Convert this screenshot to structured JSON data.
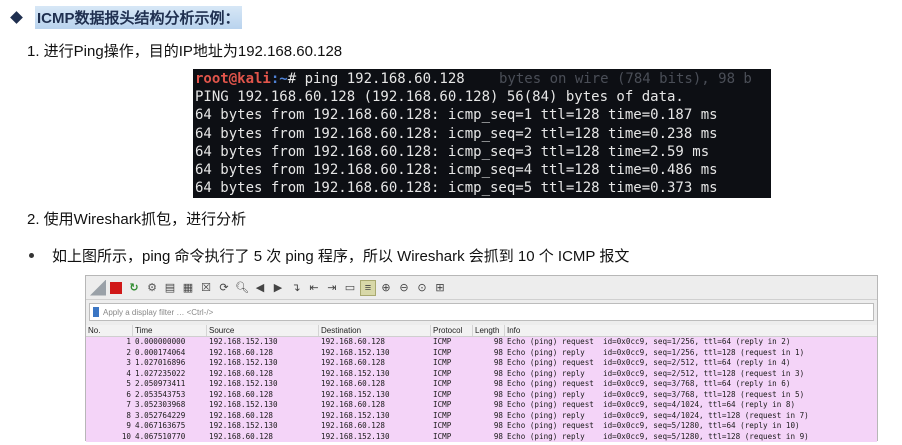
{
  "heading": "ICMP数据报头结构分析示例：",
  "step1": "1.  进行Ping操作，目的IP地址为192.168.60.128",
  "step2": "2.  使用Wireshark抓包，进行分析",
  "bullet": "如上图所示，ping 命令执行了 5 次 ping 程序，所以 Wireshark 会抓到 10 个 ICMP 报文",
  "terminal": {
    "user_host": "root@kali",
    "path": ":~",
    "prompt": "# ping 192.168.60.128",
    "ghost_top": "bytes on wire (784 bits), 98 b",
    "lines": [
      "PING 192.168.60.128 (192.168.60.128) 56(84) bytes of data.",
      "64 bytes from 192.168.60.128: icmp_seq=1 ttl=128 time=0.187 ms",
      "64 bytes from 192.168.60.128: icmp_seq=2 ttl=128 time=0.238 ms",
      "64 bytes from 192.168.60.128: icmp_seq=3 ttl=128 time=2.59 ms",
      "64 bytes from 192.168.60.128: icmp_seq=4 ttl=128 time=0.486 ms",
      "64 bytes from 192.168.60.128: icmp_seq=5 ttl=128 time=0.373 ms"
    ]
  },
  "wireshark": {
    "filter_placeholder": "Apply a display filter … <Ctrl-/>",
    "toolbar_icons": [
      "shark-fin-icon",
      "stop-icon",
      "restart-icon",
      "options-gear-icon",
      "open-file-icon",
      "save-file-icon",
      "close-file-icon",
      "reload-icon",
      "find-icon",
      "back-arrow-icon",
      "forward-arrow-icon",
      "goto-packet-icon",
      "first-packet-icon",
      "last-packet-icon",
      "autoscroll-icon",
      "colorize-icon",
      "zoom-in-icon",
      "zoom-out-icon",
      "zoom-normal-icon",
      "resize-columns-icon"
    ],
    "columns": [
      "No.",
      "Time",
      "Source",
      "Destination",
      "Protocol",
      "Length",
      "Info"
    ],
    "rows": [
      [
        "1",
        "0.000000000",
        "192.168.152.130",
        "192.168.60.128",
        "ICMP",
        "98",
        "Echo (ping) request  id=0x0cc9, seq=1/256, ttl=64 (reply in 2)"
      ],
      [
        "2",
        "0.000174064",
        "192.168.60.128",
        "192.168.152.130",
        "ICMP",
        "98",
        "Echo (ping) reply    id=0x0cc9, seq=1/256, ttl=128 (request in 1)"
      ],
      [
        "3",
        "1.027016896",
        "192.168.152.130",
        "192.168.60.128",
        "ICMP",
        "98",
        "Echo (ping) request  id=0x0cc9, seq=2/512, ttl=64 (reply in 4)"
      ],
      [
        "4",
        "1.027235022",
        "192.168.60.128",
        "192.168.152.130",
        "ICMP",
        "98",
        "Echo (ping) reply    id=0x0cc9, seq=2/512, ttl=128 (request in 3)"
      ],
      [
        "5",
        "2.050973411",
        "192.168.152.130",
        "192.168.60.128",
        "ICMP",
        "98",
        "Echo (ping) request  id=0x0cc9, seq=3/768, ttl=64 (reply in 6)"
      ],
      [
        "6",
        "2.053543753",
        "192.168.60.128",
        "192.168.152.130",
        "ICMP",
        "98",
        "Echo (ping) reply    id=0x0cc9, seq=3/768, ttl=128 (request in 5)"
      ],
      [
        "7",
        "3.052303968",
        "192.168.152.130",
        "192.168.60.128",
        "ICMP",
        "98",
        "Echo (ping) request  id=0x0cc9, seq=4/1024, ttl=64 (reply in 8)"
      ],
      [
        "8",
        "3.052764229",
        "192.168.60.128",
        "192.168.152.130",
        "ICMP",
        "98",
        "Echo (ping) reply    id=0x0cc9, seq=4/1024, ttl=128 (request in 7)"
      ],
      [
        "9",
        "4.067163675",
        "192.168.152.130",
        "192.168.60.128",
        "ICMP",
        "98",
        "Echo (ping) request  id=0x0cc9, seq=5/1280, ttl=64 (reply in 10)"
      ],
      [
        "10",
        "4.067510770",
        "192.168.60.128",
        "192.168.152.130",
        "ICMP",
        "98",
        "Echo (ping) reply    id=0x0cc9, seq=5/1280, ttl=128 (request in 9)"
      ]
    ],
    "row_color": "#f4d4f8"
  }
}
